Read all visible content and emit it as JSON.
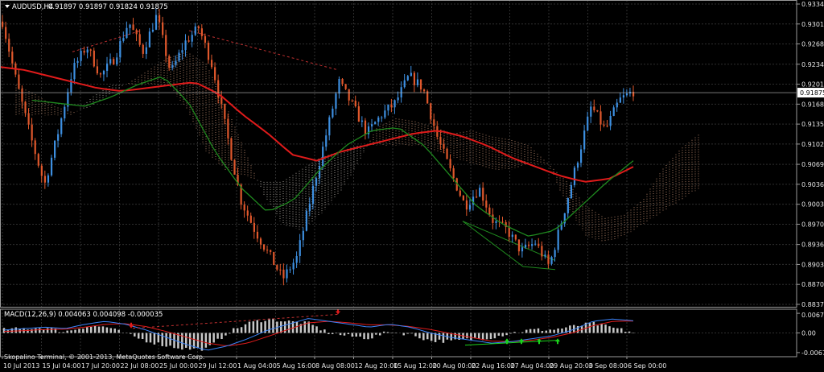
{
  "header": {
    "symbol": "AUDUSD,H4",
    "ohlc": "0.91897 0.91897 0.91824 0.91875"
  },
  "colors": {
    "background": "#000000",
    "grid": "#2f2f2f",
    "frame": "#9a9a9a",
    "bull": "#3d8fe0",
    "bear": "#e0582c",
    "ma_fast": "#1f8a1f",
    "ma_slow": "#e01b1b",
    "cloud_a": "#c69275",
    "cloud_b": "#bdb6b0",
    "trend": "#c03030",
    "price_tag_bg": "#ffffff",
    "macd_hist": "#c8c8c8",
    "macd_main": "#3b82f6",
    "macd_signal": "#e01b1b",
    "arrow": "#1bd31b"
  },
  "chart_data": {
    "type": "candlestick",
    "main": {
      "price_ticks": [
        "0.93340",
        "0.93010",
        "0.92680",
        "0.92345",
        "0.92015",
        "0.91685",
        "0.91355",
        "0.91025",
        "0.90690",
        "0.90360",
        "0.90030",
        "0.89700",
        "0.89365",
        "0.89035",
        "0.88705",
        "0.88375"
      ],
      "ylim": [
        0.88375,
        0.9334
      ],
      "current_price": "0.91875",
      "grid": true
    },
    "time_labels": [
      "10 Jul 2013",
      "15 Jul 04:00",
      "17 Jul 20:00",
      "22 Jul 08:00",
      "25 Jul 00:00",
      "29 Jul 12:00",
      "1 Aug 04:00",
      "5 Aug 16:00",
      "8 Aug 08:00",
      "12 Aug 20:00",
      "15 Aug 12:00",
      "20 Aug 00:00",
      "22 Aug 16:00",
      "27 Aug 04:00",
      "29 Aug 20:00",
      "3 Sep 08:00",
      "6 Sep 00:00"
    ],
    "price_path": [
      0.9305,
      0.9205,
      0.9115,
      0.9035,
      0.9125,
      0.9225,
      0.9265,
      0.9215,
      0.9245,
      0.9305,
      0.9255,
      0.9315,
      0.922,
      0.927,
      0.9295,
      0.923,
      0.912,
      0.901,
      0.896,
      0.892,
      0.888,
      0.8915,
      0.9015,
      0.911,
      0.9205,
      0.9165,
      0.912,
      0.915,
      0.917,
      0.9215,
      0.9195,
      0.9115,
      0.9055,
      0.9,
      0.903,
      0.8975,
      0.896,
      0.8925,
      0.894,
      0.89,
      0.8985,
      0.9075,
      0.9165,
      0.9125,
      0.9175,
      0.919
    ],
    "ichimoku_span_a": [
      0.92,
      0.9185,
      0.9165,
      0.9155,
      0.9165,
      0.9185,
      0.9205,
      0.9225,
      0.9245,
      0.9255,
      0.9235,
      0.917,
      0.9095,
      0.902,
      0.897,
      0.896,
      0.8985,
      0.902,
      0.907,
      0.913,
      0.9145,
      0.914,
      0.913,
      0.912,
      0.9125,
      0.9115,
      0.911,
      0.91,
      0.907,
      0.904,
      0.9,
      0.898,
      0.8985,
      0.901,
      0.906,
      0.9095,
      0.912
    ],
    "ichimoku_span_b": [
      0.915,
      0.915,
      0.915,
      0.915,
      0.918,
      0.92,
      0.92,
      0.92,
      0.92,
      0.916,
      0.909,
      0.906,
      0.905,
      0.904,
      0.904,
      0.906,
      0.908,
      0.909,
      0.91,
      0.91,
      0.91,
      0.91,
      0.909,
      0.908,
      0.907,
      0.906,
      0.906,
      0.907,
      0.907,
      0.9,
      0.895,
      0.894,
      0.895,
      0.897,
      0.899,
      0.901,
      0.903
    ],
    "ma_slow": [
      0.923,
      0.9225,
      0.9215,
      0.9205,
      0.9195,
      0.919,
      0.9195,
      0.92,
      0.9205,
      0.9185,
      0.915,
      0.912,
      0.9085,
      0.9075,
      0.909,
      0.91,
      0.911,
      0.912,
      0.9125,
      0.9115,
      0.91,
      0.908,
      0.9065,
      0.905,
      0.904,
      0.9045,
      0.9065
    ],
    "ma_fast": [
      0.9175,
      0.917,
      0.9165,
      0.918,
      0.92,
      0.9215,
      0.917,
      0.909,
      0.903,
      0.899,
      0.901,
      0.906,
      0.91,
      0.9125,
      0.913,
      0.91,
      0.905,
      0.9,
      0.897,
      0.895,
      0.896,
      0.9,
      0.904,
      0.9075
    ],
    "macd": {
      "title": "MACD(12,26,9) 0.004063 0.004098 -0.000035",
      "ticks": [
        "0.006774",
        "0.00",
        "-0.006774"
      ],
      "ylim": [
        -0.0068,
        0.0068
      ],
      "main": [
        0.001,
        0.0015,
        0.002,
        0.0015,
        0.003,
        0.004,
        0.003,
        0.001,
        -0.0015,
        -0.004,
        -0.006,
        -0.0045,
        -0.002,
        0.001,
        0.003,
        0.005,
        0.004,
        0.003,
        0.002,
        0.003,
        0.002,
        0.0,
        -0.0015,
        -0.0025,
        -0.0035,
        -0.003,
        -0.002,
        -0.001,
        0.001,
        0.004,
        0.0048,
        0.0042
      ],
      "signal": [
        0.0005,
        0.0008,
        0.0012,
        0.0013,
        0.002,
        0.003,
        0.0032,
        0.0022,
        0.0005,
        -0.0015,
        -0.0035,
        -0.0045,
        -0.0035,
        -0.0012,
        0.0012,
        0.0035,
        0.004,
        0.0035,
        0.0028,
        0.0028,
        0.0022,
        0.0012,
        -0.0002,
        -0.0015,
        -0.0028,
        -0.003,
        -0.0025,
        -0.0015,
        0.0,
        0.0025,
        0.004,
        0.0041
      ]
    }
  },
  "footer": {
    "copyright": "Skopalino Terminal, © 2001-2013, MetaQuotes Software Corp."
  }
}
